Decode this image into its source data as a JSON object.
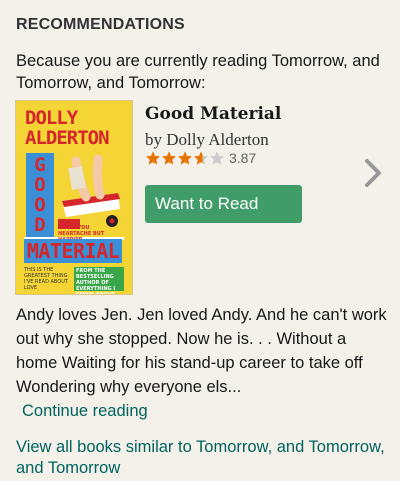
{
  "section": {
    "heading": "RECOMMENDATIONS",
    "intro_prefix": "Because you are currently reading ",
    "intro_book": "Tomorrow, and Tomorrow, and Tomorrow",
    "intro_suffix": ":"
  },
  "book": {
    "title": "Good Material",
    "byline": "by Dolly Alderton",
    "rating_value": 3.87,
    "rating_text": "3.87",
    "star_filled_color": "#e87400",
    "star_empty_color": "#cccccc",
    "cover": {
      "author_line1": "DOLLY",
      "author_line2": "ALDERTON",
      "title_letters": [
        "G",
        "O",
        "O",
        "D"
      ],
      "title_bottom": "MATERIAL",
      "blurb": "SAVES YOU HEARTACHE BUT HAPPIER, IRRESISTIBLE",
      "banner": "FROM THE BESTSELLING AUTHOR OF EVERYTHING I KNOW ABOUT LOVE AND GHOSTS",
      "quote": "THIS IS THE GREATEST THING I'VE READ ABOUT LOVE"
    },
    "description": "Andy loves Jen. Jen loved Andy. And he can't work out why she stopped. Now he is. . . Without a home Waiting for his stand-up career to take off Wondering why everyone els...",
    "continue_label": "Continue reading",
    "want_label": "Want to Read"
  },
  "footer": {
    "view_all": "View all books similar to Tomorrow, and Tomorrow, and Tomorrow"
  },
  "icons": {
    "next": "chevron-right-icon",
    "star": "star-icon"
  }
}
